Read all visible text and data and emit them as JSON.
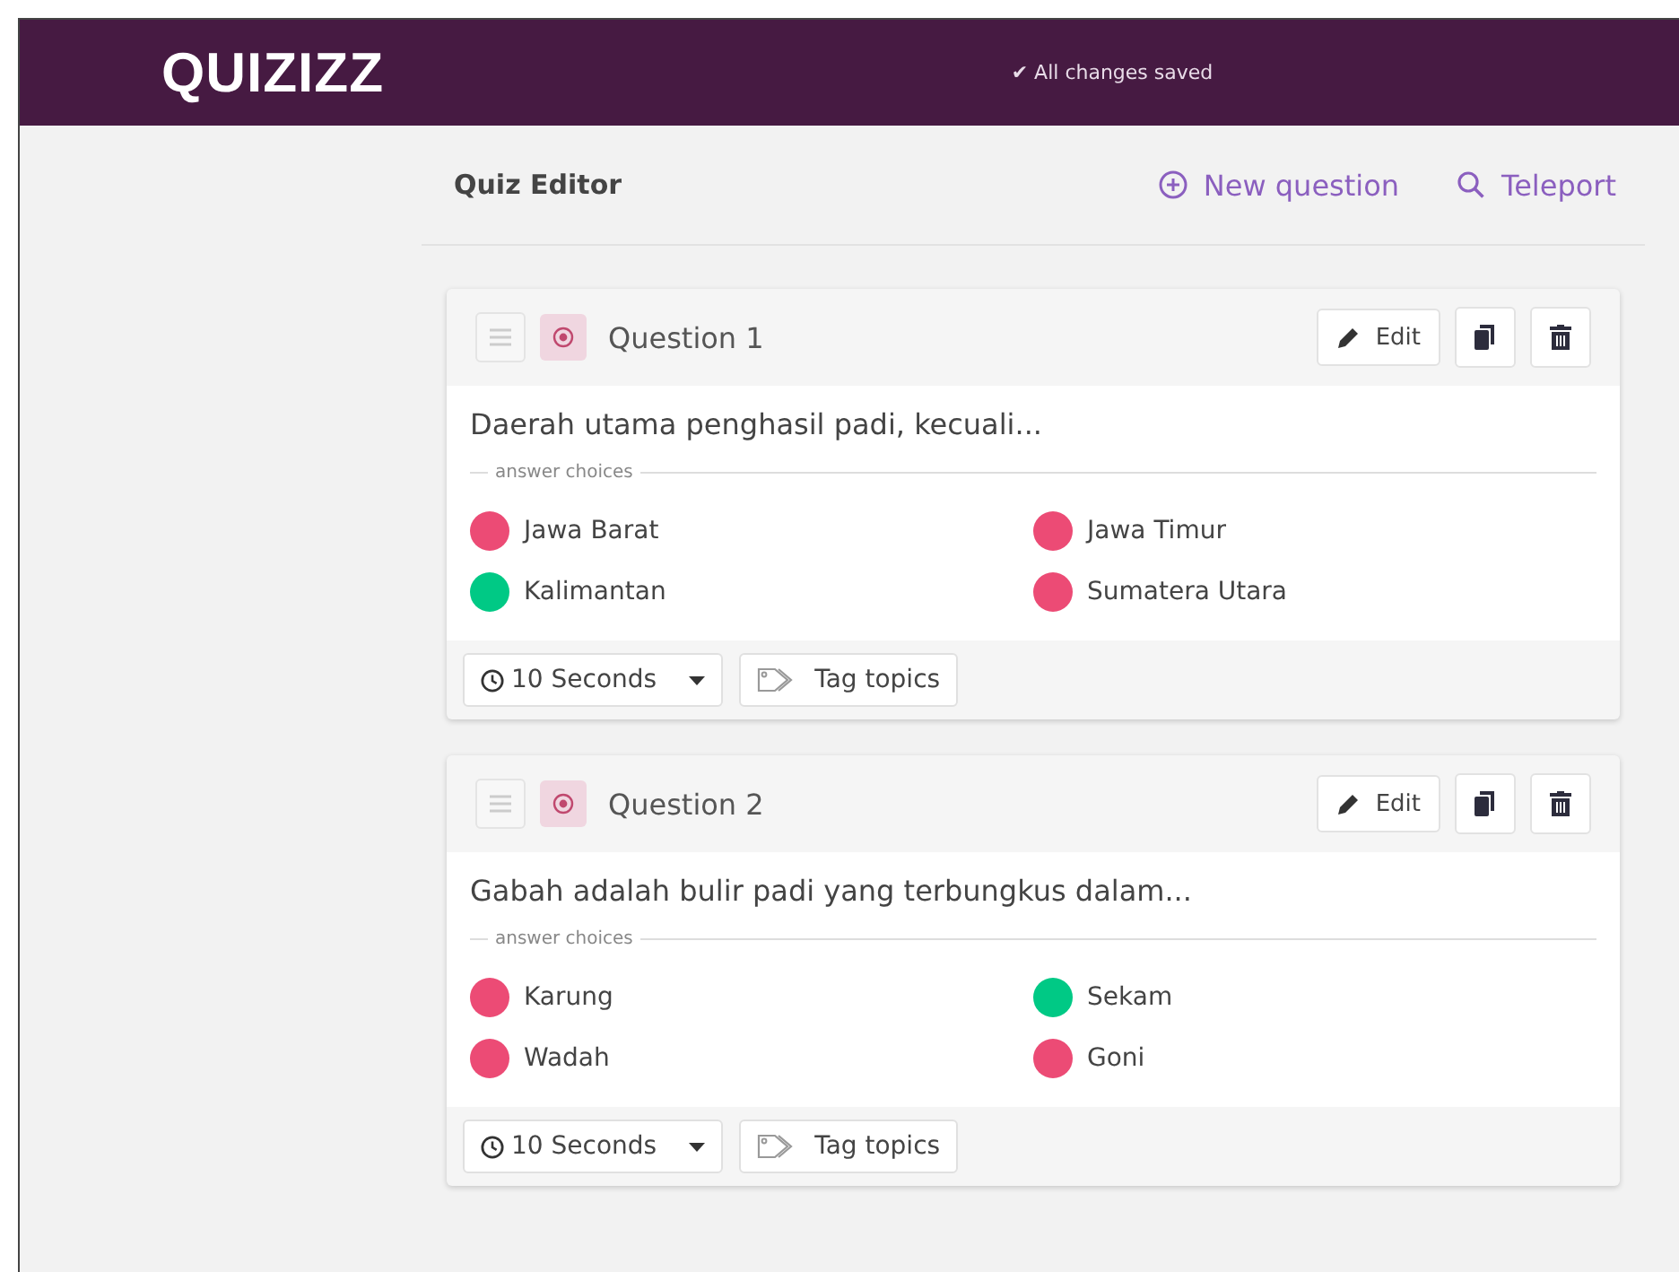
{
  "header": {
    "logo": "QUIZIZZ",
    "save_status": "✔ All changes saved"
  },
  "toolbar": {
    "title": "Quiz Editor",
    "actions": [
      {
        "kind": "new",
        "label": "New question"
      },
      {
        "kind": "search",
        "label": "Teleport"
      }
    ]
  },
  "questions": [
    {
      "title": "Question 1",
      "edit_label": "Edit",
      "text": "Daerah utama penghasil padi, kecuali...",
      "choices_label": "answer choices",
      "choices": [
        {
          "text": "Jawa Barat",
          "correct": false
        },
        {
          "text": "Jawa Timur",
          "correct": false
        },
        {
          "text": "Kalimantan",
          "correct": true
        },
        {
          "text": "Sumatera Utara",
          "correct": false
        }
      ],
      "time": "10 Seconds",
      "tag_label": "Tag topics"
    },
    {
      "title": "Question 2",
      "edit_label": "Edit",
      "text": "Gabah adalah bulir padi yang terbungkus dalam...",
      "choices_label": "answer choices",
      "choices": [
        {
          "text": "Karung",
          "correct": false
        },
        {
          "text": "Sekam",
          "correct": true
        },
        {
          "text": "Wadah",
          "correct": false
        },
        {
          "text": "Goni",
          "correct": false
        }
      ],
      "time": "10 Seconds",
      "tag_label": "Tag topics"
    }
  ]
}
